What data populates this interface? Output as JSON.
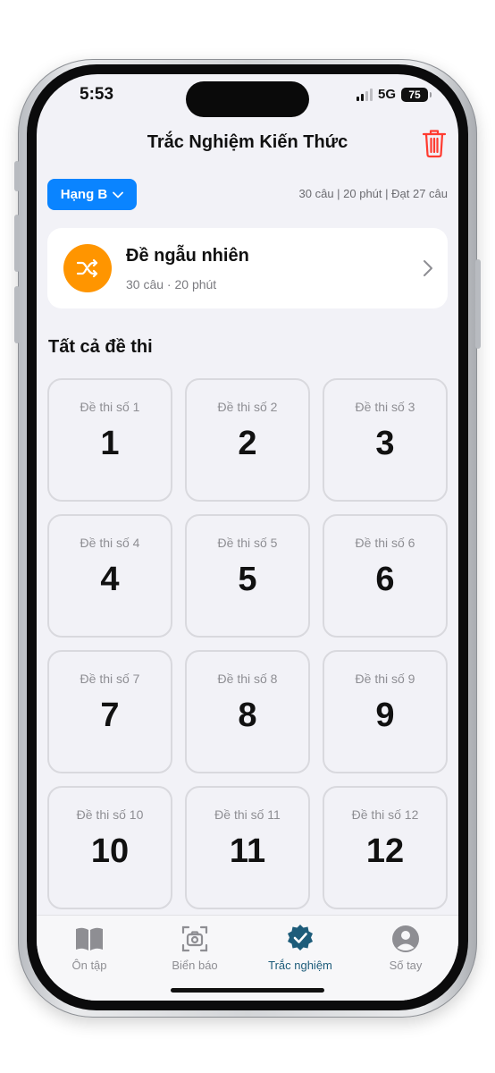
{
  "status_bar": {
    "time": "5:53",
    "network": "5G",
    "battery": "75"
  },
  "header": {
    "title": "Trắc Nghiệm Kiến Thức",
    "delete_icon": "trash-icon"
  },
  "filter": {
    "class_label": "Hạng B",
    "exam_info": "30 câu | 20 phút | Đạt 27 câu"
  },
  "random_exam": {
    "title": "Đề ngẫu nhiên",
    "subtitle": "30 câu · 20 phút",
    "icon": "shuffle-icon"
  },
  "section_title": "Tất cả đề thi",
  "exams": [
    {
      "label": "Đề thi số 1",
      "number": "1"
    },
    {
      "label": "Đề thi số 2",
      "number": "2"
    },
    {
      "label": "Đề thi số 3",
      "number": "3"
    },
    {
      "label": "Đề thi số 4",
      "number": "4"
    },
    {
      "label": "Đề thi số 5",
      "number": "5"
    },
    {
      "label": "Đề thi số 6",
      "number": "6"
    },
    {
      "label": "Đề thi số 7",
      "number": "7"
    },
    {
      "label": "Đề thi số 8",
      "number": "8"
    },
    {
      "label": "Đề thi số 9",
      "number": "9"
    },
    {
      "label": "Đề thi số 10",
      "number": "10"
    },
    {
      "label": "Đề thi số 11",
      "number": "11"
    },
    {
      "label": "Đề thi số 12",
      "number": "12"
    }
  ],
  "tab_bar": {
    "tabs": [
      {
        "label": "Ôn tập",
        "icon": "book-icon"
      },
      {
        "label": "Biển báo",
        "icon": "camera-scan-icon"
      },
      {
        "label": "Trắc nghiệm",
        "icon": "verified-badge-icon"
      },
      {
        "label": "Số tay",
        "icon": "person-circle-icon"
      }
    ],
    "active_index": 2
  },
  "colors": {
    "accent_blue": "#0a84ff",
    "orange": "#ff9500",
    "delete_red": "#ff3b30",
    "active_tab": "#1d5c7a",
    "inactive": "#8e8e93"
  }
}
